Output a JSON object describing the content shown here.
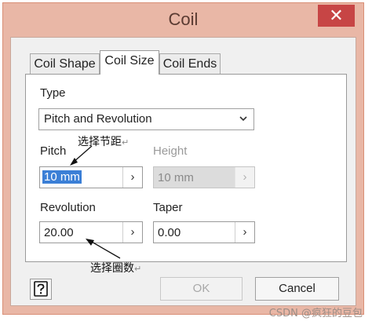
{
  "window": {
    "title": "Coil",
    "close_glyph": "✕"
  },
  "tabs": [
    {
      "label": "Coil Shape",
      "active": false
    },
    {
      "label": "Coil Size",
      "active": true
    },
    {
      "label": "Coil Ends",
      "active": false
    }
  ],
  "panel": {
    "type_label": "Type",
    "type_value": "Pitch and Revolution",
    "pitch_label": "Pitch",
    "pitch_value": "10 mm",
    "height_label": "Height",
    "height_value": "10 mm",
    "revolution_label": "Revolution",
    "revolution_value": "20.00",
    "taper_label": "Taper",
    "taper_value": "0.00",
    "arrow_glyph": "›"
  },
  "annotations": {
    "pitch_note": "选择节距",
    "revolution_note": "选择圈数",
    "return_mark": "↵"
  },
  "buttons": {
    "ok": "OK",
    "cancel": "Cancel",
    "help_icon": "question-icon"
  },
  "watermark": "CSDN @疯狂的豆包",
  "colors": {
    "title_bar": "#e9b7a6",
    "close": "#c74545",
    "selection": "#3b7fd6"
  }
}
